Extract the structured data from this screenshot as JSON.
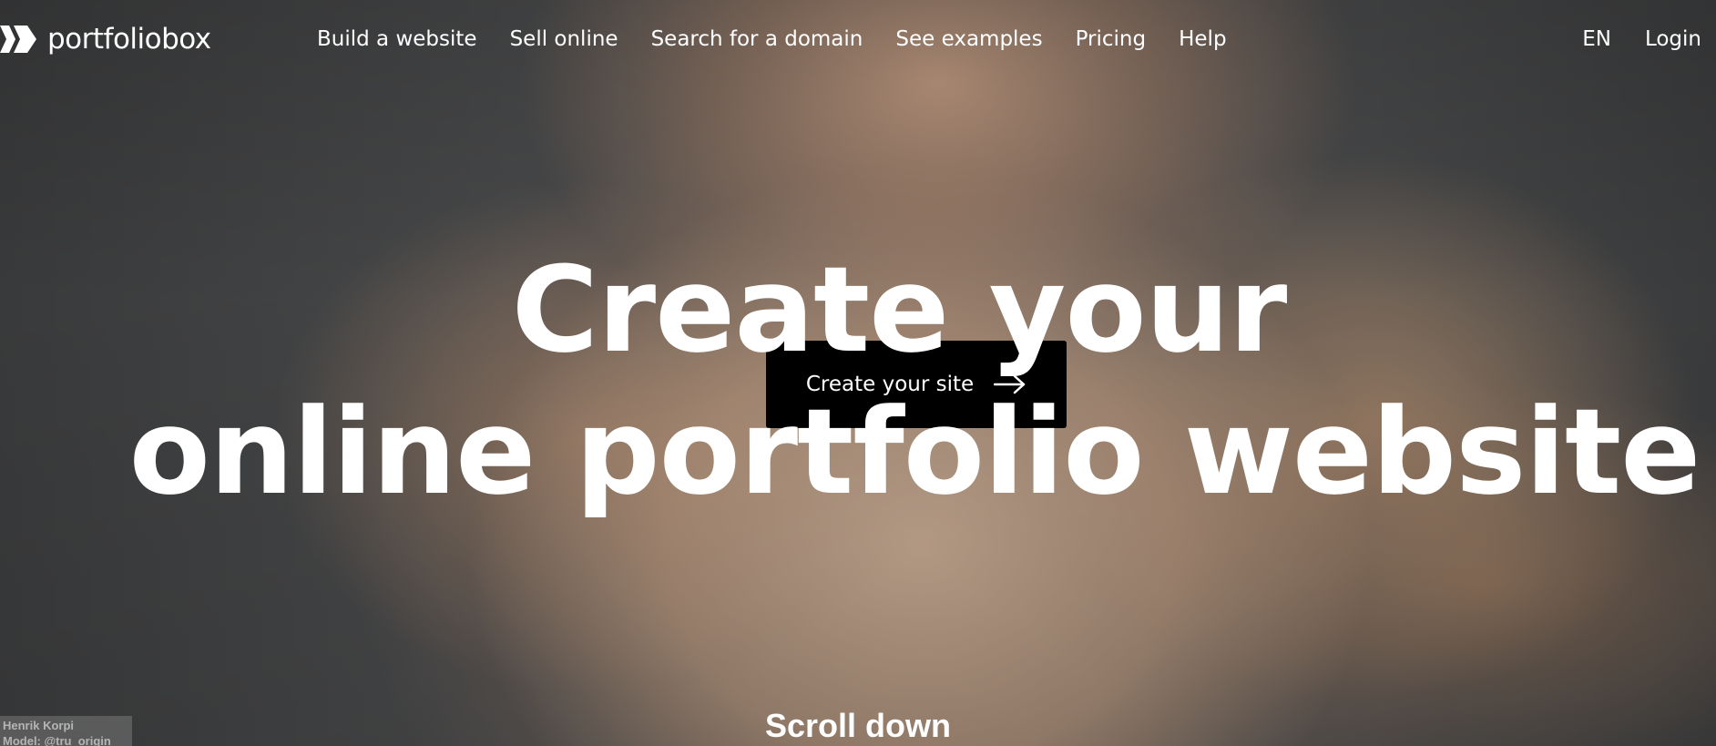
{
  "brand": {
    "name": "portfoliobox"
  },
  "nav": {
    "items": [
      {
        "label": "Build a website"
      },
      {
        "label": "Sell online"
      },
      {
        "label": "Search for a domain"
      },
      {
        "label": "See examples"
      },
      {
        "label": "Pricing"
      },
      {
        "label": "Help"
      }
    ]
  },
  "header_right": {
    "language": "EN",
    "login": "Login"
  },
  "hero": {
    "headline_line1": "Create your",
    "headline_line2": "online portfolio website",
    "cta_label": "Create your site",
    "cta_icon": "arrow-right-icon",
    "scroll_label": "Scroll down"
  },
  "photo_credit": {
    "line1": "Henrik Korpi",
    "line2": "Model: @tru_origin"
  },
  "colors": {
    "text": "#ffffff",
    "cta_background": "#000000",
    "background": "#4a4b4c"
  }
}
